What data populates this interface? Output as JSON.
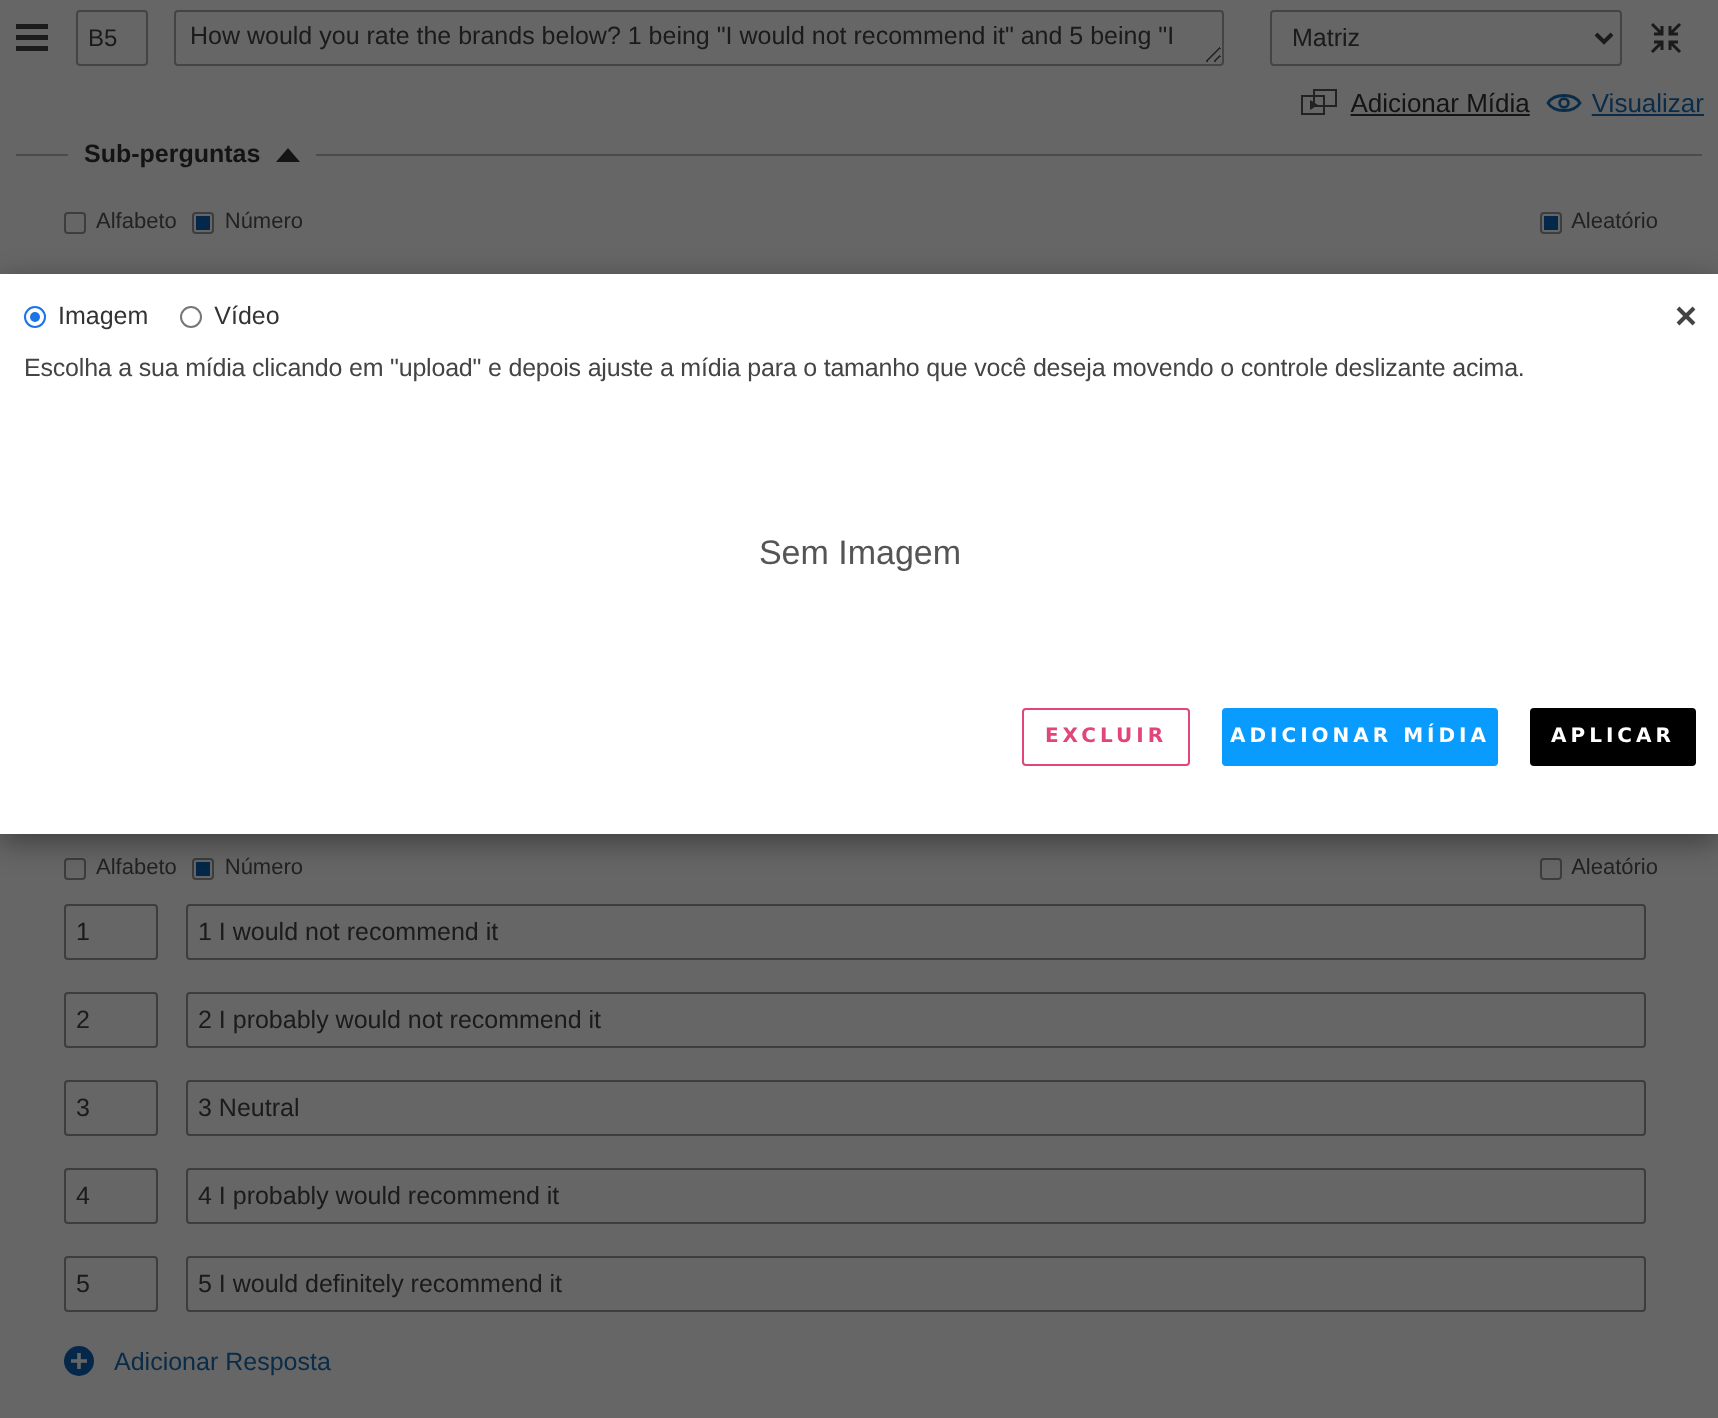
{
  "header": {
    "code": "B5",
    "question": "How would you rate the brands below? 1 being \"I would not recommend it\" and 5 being \"I",
    "type_select": "Matriz"
  },
  "links": [
    {
      "label": "Adicionar Mídia",
      "kind": "media"
    },
    {
      "label": "Visualizar",
      "kind": "preview"
    }
  ],
  "subquestions": {
    "title": "Sub-perguntas",
    "expanded": true,
    "options": [
      {
        "label": "Alfabeto",
        "checked": false
      },
      {
        "label": "Número",
        "checked": true
      }
    ],
    "random": {
      "label": "Aleatório",
      "checked": true
    }
  },
  "answers": {
    "options": [
      {
        "label": "Alfabeto",
        "checked": false
      },
      {
        "label": "Número",
        "checked": true
      }
    ],
    "random": {
      "label": "Aleatório",
      "checked": false
    },
    "rows": [
      {
        "code": "1",
        "text": "1 I would not recommend it"
      },
      {
        "code": "2",
        "text": "2 I probably would not recommend it"
      },
      {
        "code": "3",
        "text": "3 Neutral"
      },
      {
        "code": "4",
        "text": "4 I probably would recommend it"
      },
      {
        "code": "5",
        "text": "5 I would definitely recommend it"
      }
    ],
    "add_label": "Adicionar Resposta"
  },
  "media_dialog": {
    "media_types": [
      {
        "label": "Imagem",
        "selected": true
      },
      {
        "label": "Vídeo",
        "selected": false
      }
    ],
    "instructions": "Escolha a sua mídia clicando em \"upload\" e depois ajuste a mídia para o tamanho que você deseja movendo o controle deslizante acima.",
    "empty_text": "Sem Imagem",
    "buttons": [
      {
        "label": "EXCLUIR",
        "kind": "outline"
      },
      {
        "label": "ADICIONAR MÍDIA",
        "kind": "primary"
      },
      {
        "label": "APLICAR",
        "kind": "dark"
      }
    ]
  }
}
